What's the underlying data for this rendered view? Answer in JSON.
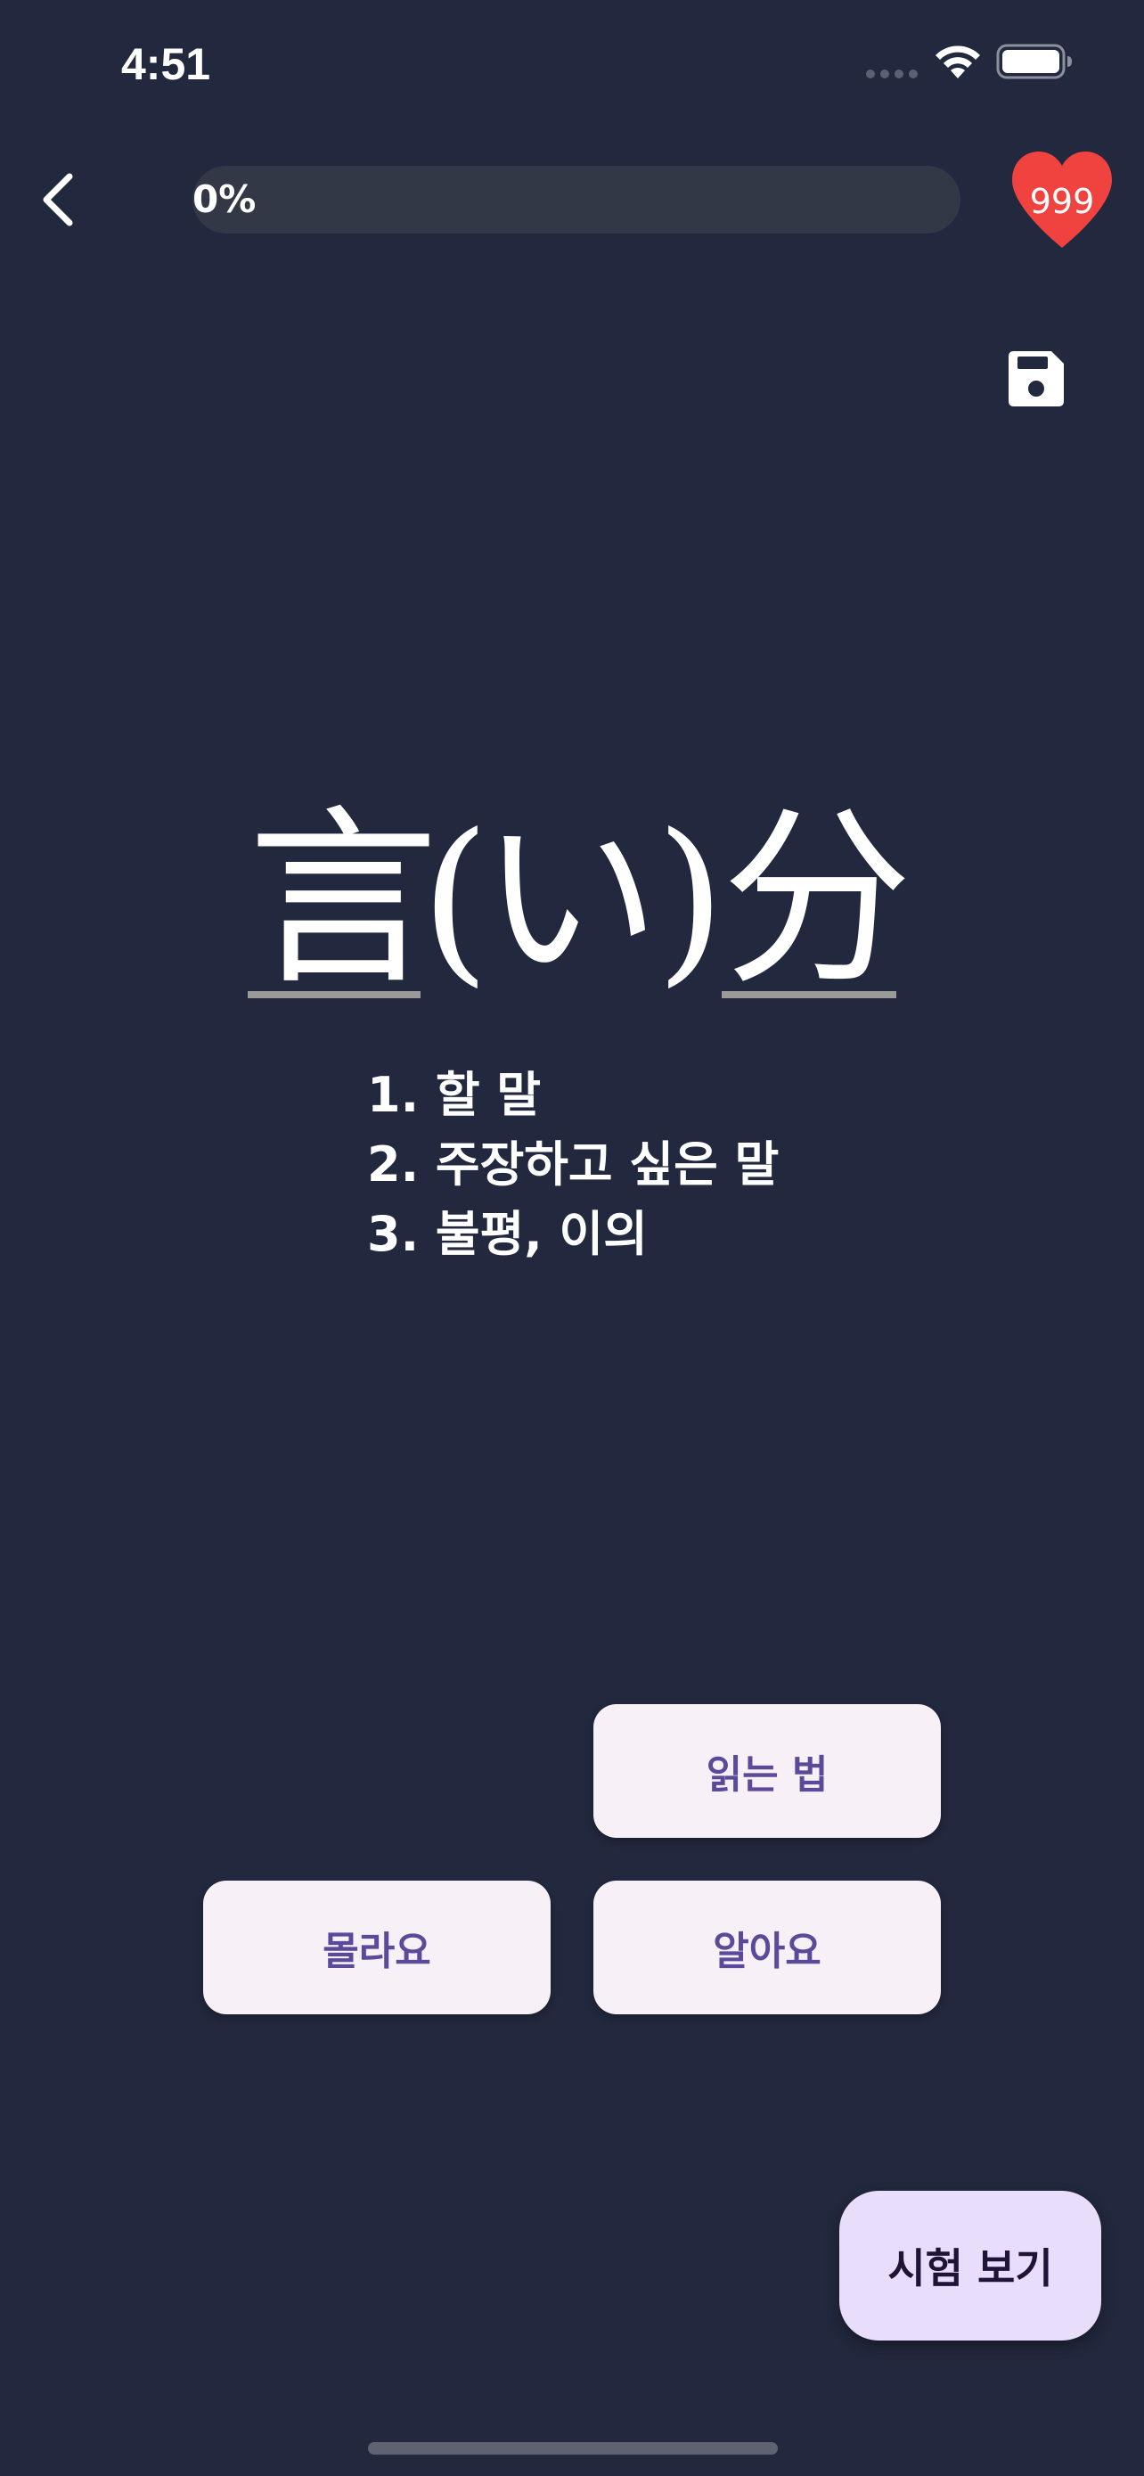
{
  "status_bar": {
    "time": "4:51",
    "icons": [
      "signal-icon",
      "wifi-icon",
      "battery-icon"
    ]
  },
  "top_bar": {
    "back_icon": "chevron-left-icon",
    "progress": {
      "label": "0%",
      "value": 0
    },
    "hearts": {
      "icon": "heart-icon",
      "count": "999",
      "color": "#f0433f"
    },
    "save_icon": "floppy-disk-icon"
  },
  "word": {
    "kanji_1": "言",
    "kana_open": "(",
    "kana": "い",
    "kana_close": ")",
    "kanji_2": "分"
  },
  "meanings": [
    "1. 할 말",
    "2. 주장하고 싶은 말",
    "3. 불평, 이의"
  ],
  "buttons": {
    "reading": "읽는 법",
    "dont_know": "몰라요",
    "know": "알아요",
    "take_test": "시험 보기"
  },
  "colors": {
    "background": "#22283d",
    "button_bg": "#f7f1f7",
    "button_text": "#5a4a99",
    "test_button_bg": "#e8ddfb",
    "heart": "#f0433f"
  }
}
